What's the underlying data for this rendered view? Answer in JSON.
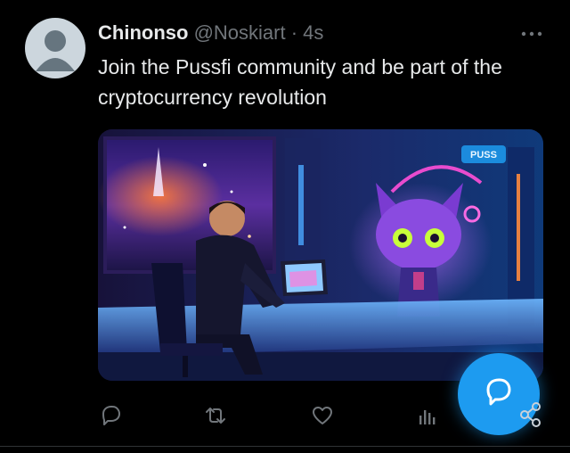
{
  "tweet": {
    "author_name": "Chinonso",
    "handle": "@Noskiart",
    "separator": "·",
    "time": "4s",
    "text": "Join the Pussfi community and be part of the cryptocurrency revolution"
  },
  "media": {
    "screen_sign_text": "PUSS",
    "alt_icons": [
      "robot-cat-character",
      "man-at-desk",
      "tablet-device"
    ]
  },
  "actions": {
    "icons": [
      "reply-icon",
      "retweet-icon",
      "like-icon",
      "views-icon",
      "share-icon"
    ]
  },
  "fab": {
    "icon": "compose-chat-icon"
  },
  "colors": {
    "background": "#000000",
    "text_primary": "#e7e9ea",
    "text_secondary": "#71767b",
    "accent": "#1d9bf0"
  }
}
